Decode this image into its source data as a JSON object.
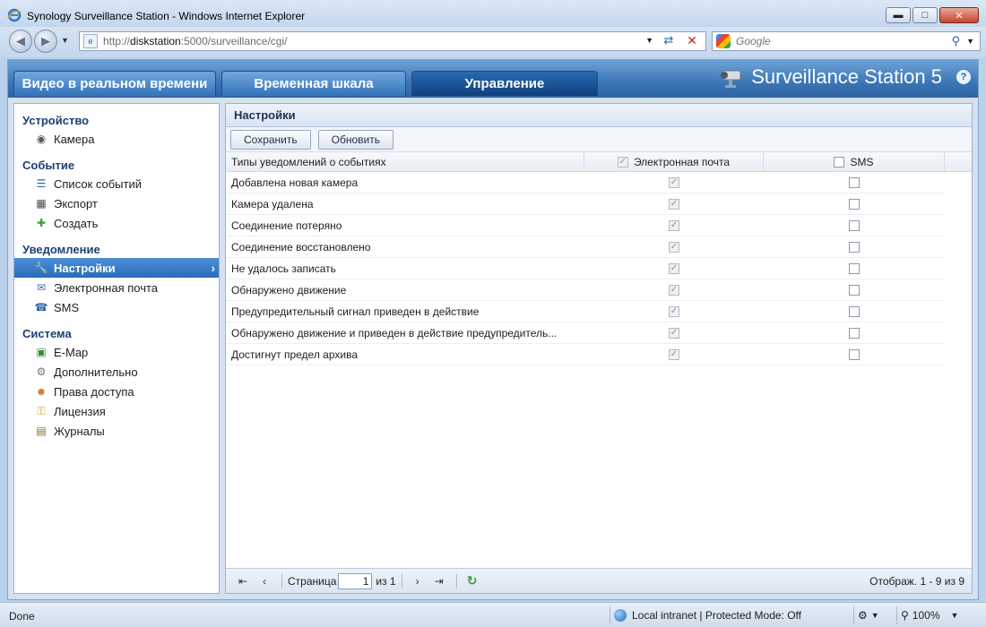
{
  "window": {
    "title": "Synology Surveillance Station - Windows Internet Explorer",
    "minimize_icon": "minimize-icon",
    "maximize_icon": "maximize-icon",
    "close_label": "✕"
  },
  "address": {
    "url_prefix": "http://",
    "url_host": "diskstation",
    "url_rest": ":5000/surveillance/cgi/",
    "search_placeholder": "Google"
  },
  "app": {
    "tabs": [
      {
        "label": "Видео в реальном времени"
      },
      {
        "label": "Временная шкала"
      },
      {
        "label": "Управление"
      }
    ],
    "brand": "Surveillance Station 5",
    "help_label": "?"
  },
  "sidebar": {
    "groups": [
      {
        "title": "Устройство",
        "items": [
          {
            "label": "Камера",
            "icon": "camera-icon"
          }
        ]
      },
      {
        "title": "Событие",
        "items": [
          {
            "label": "Список событий",
            "icon": "event-list-icon"
          },
          {
            "label": "Экспорт",
            "icon": "export-icon"
          },
          {
            "label": "Создать",
            "icon": "create-icon"
          }
        ]
      },
      {
        "title": "Уведомление",
        "items": [
          {
            "label": "Настройки",
            "icon": "wrench-icon",
            "active": true
          },
          {
            "label": "Электронная почта",
            "icon": "email-icon"
          },
          {
            "label": "SMS",
            "icon": "sms-icon"
          }
        ]
      },
      {
        "title": "Система",
        "items": [
          {
            "label": "E-Map",
            "icon": "emap-icon"
          },
          {
            "label": "Дополнительно",
            "icon": "gear-icon"
          },
          {
            "label": "Права доступа",
            "icon": "users-icon"
          },
          {
            "label": "Лицензия",
            "icon": "key-icon"
          },
          {
            "label": "Журналы",
            "icon": "book-icon"
          }
        ]
      }
    ]
  },
  "main": {
    "title": "Настройки",
    "save_label": "Сохранить",
    "refresh_label": "Обновить",
    "columns": {
      "type": "Типы уведомлений о событиях",
      "email": "Электронная почта",
      "sms": "SMS"
    },
    "header_email_checked": true,
    "header_sms_checked": false,
    "rows": [
      {
        "type": "Добавлена новая камера",
        "email": true,
        "sms": false
      },
      {
        "type": "Камера удалена",
        "email": true,
        "sms": false
      },
      {
        "type": "Соединение потеряно",
        "email": true,
        "sms": false
      },
      {
        "type": "Соединение восстановлено",
        "email": true,
        "sms": false
      },
      {
        "type": "Не удалось записать",
        "email": true,
        "sms": false
      },
      {
        "type": "Обнаружено движение",
        "email": true,
        "sms": false
      },
      {
        "type": "Предупредительный сигнал приведен в действие",
        "email": true,
        "sms": false
      },
      {
        "type": "Обнаружено движение и приведен в действие предупредитель...",
        "email": true,
        "sms": false
      },
      {
        "type": "Достигнут предел архива",
        "email": true,
        "sms": false
      }
    ],
    "pager": {
      "page_label": "Страница",
      "page_value": "1",
      "of_label": "из 1",
      "display_text": "Отображ. 1 - 9 из 9"
    }
  },
  "status": {
    "left": "Done",
    "zone": "Local intranet | Protected Mode: Off",
    "zoom": "100%"
  }
}
